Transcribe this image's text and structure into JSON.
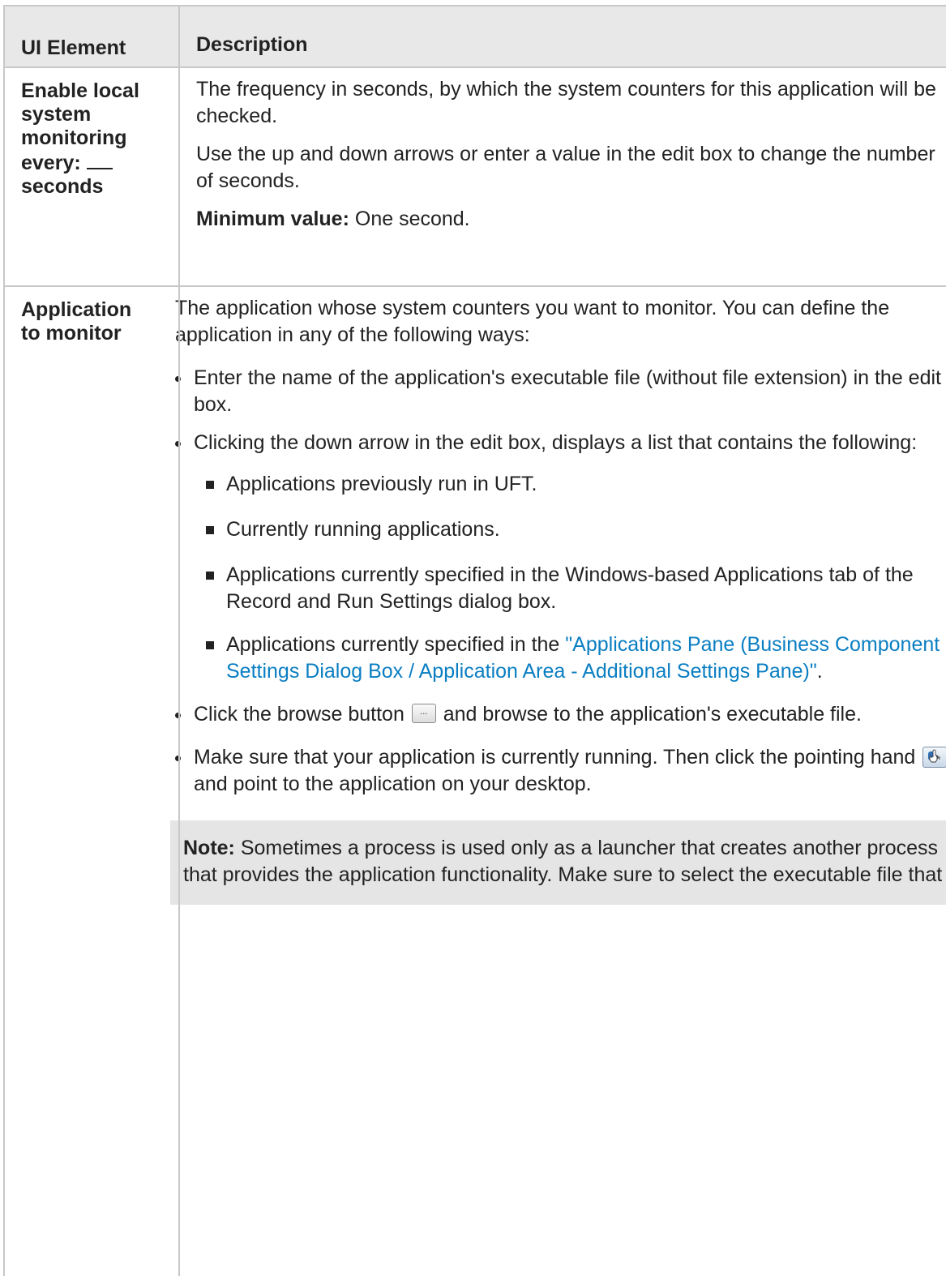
{
  "header": {
    "col1": "UI Element",
    "col2": "Description"
  },
  "row1": {
    "element_prefix": "Enable local system monitoring every:",
    "element_suffix": "seconds",
    "para1": "The frequency in seconds, by which the system counters for this application will be checked.",
    "para2": "Use the up and down arrows or enter a value in the edit box to change the number of seconds.",
    "min_label": "Minimum value:",
    "min_text": " One second."
  },
  "row2": {
    "element": "Application to monitor",
    "intro": "The application whose system counters you want to monitor. You can define the application in any of the following ways:",
    "bullet1": "Enter the name of the application's executable file (without file extension) in the edit box.",
    "bullet2": "Clicking the down arrow in the edit box, displays a list that contains the following:",
    "sub1": "Applications previously run in UFT.",
    "sub2": "Currently running applications.",
    "sub3": "Applications currently specified in the Windows-based Applications tab of the Record and Run Settings dialog box.",
    "sub4_prefix": "Applications currently specified in the ",
    "sub4_link": "\"Applications Pane (Business Component Settings Dialog Box / Application Area - Additional Settings Pane)\"",
    "sub4_suffix": ".",
    "bullet3_prefix": "Click the browse button ",
    "browse_label": "...",
    "bullet3_suffix": " and browse to the application's executable file.",
    "bullet4_prefix": "Make sure that your application is currently running. Then click the pointing hand ",
    "bullet4_suffix": " and point to the application on your desktop.",
    "note_label": "Note:",
    "note_text": " Sometimes a process is used only as a launcher that creates another process that provides the application functionality. Make sure to select the executable file that"
  }
}
